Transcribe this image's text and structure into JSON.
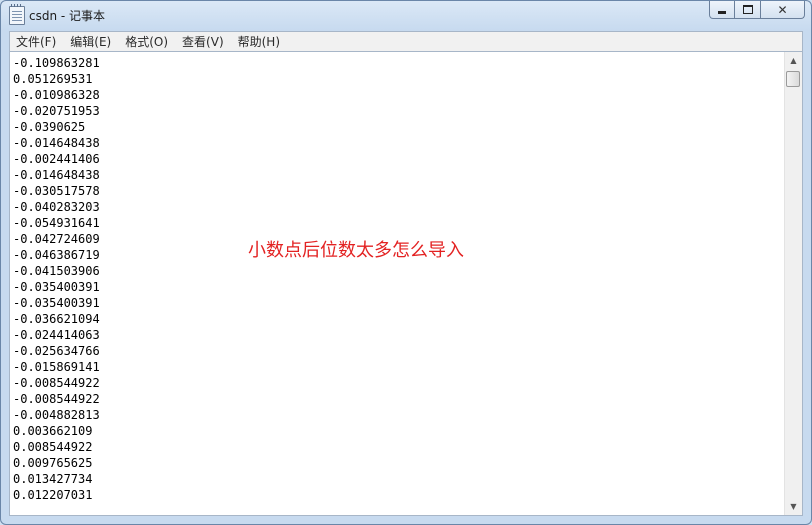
{
  "window": {
    "title": "csdn - 记事本",
    "icon": "notepad-icon",
    "caption_buttons": {
      "minimize_icon": "minimize-icon",
      "maximize_icon": "maximize-icon",
      "close_icon": "close-icon",
      "close_glyph": "✕"
    }
  },
  "menu": {
    "items": [
      {
        "label": "文件(F)"
      },
      {
        "label": "编辑(E)"
      },
      {
        "label": "格式(O)"
      },
      {
        "label": "查看(V)"
      },
      {
        "label": "帮助(H)"
      }
    ]
  },
  "editor": {
    "lines": [
      "-0.109863281",
      "0.051269531",
      "-0.010986328",
      "-0.020751953",
      "-0.0390625",
      "-0.014648438",
      "-0.002441406",
      "-0.014648438",
      "-0.030517578",
      "-0.040283203",
      "-0.054931641",
      "-0.042724609",
      "-0.046386719",
      "-0.041503906",
      "-0.035400391",
      "-0.035400391",
      "-0.036621094",
      "-0.024414063",
      "-0.025634766",
      "-0.015869141",
      "-0.008544922",
      "-0.008544922",
      "-0.004882813",
      "0.003662109",
      "0.008544922",
      "0.009765625",
      "0.013427734",
      "0.012207031"
    ],
    "annotation": "小数点后位数太多怎么导入",
    "annotation_color": "#e32222"
  },
  "scrollbar": {
    "up_glyph": "▲",
    "down_glyph": "▼"
  }
}
